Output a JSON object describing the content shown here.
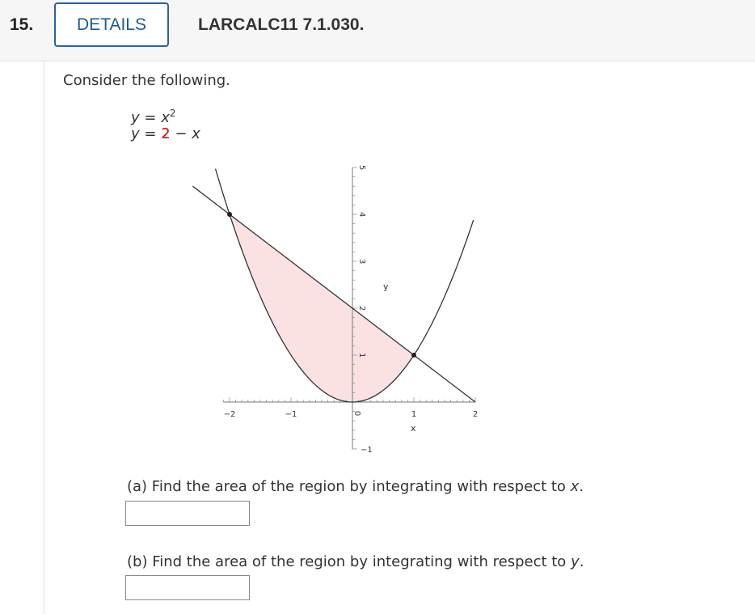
{
  "header": {
    "question_number": "15.",
    "details_label": "DETAILS",
    "question_code": "LARCALC11 7.1.030."
  },
  "prompt": "Consider the following.",
  "equations": {
    "eq1": {
      "lhs": "y",
      "eq": " = ",
      "base": "x",
      "exp": "2"
    },
    "eq2": {
      "lhs": "y",
      "eq": " = ",
      "red": "2",
      "rest": " − ",
      "var": "x"
    }
  },
  "graph": {
    "x_axis_label": "x",
    "y_axis_label": "y",
    "x_ticks": [
      "−2",
      "−1",
      "0",
      "1",
      "2"
    ],
    "y_ticks": [
      "5",
      "4",
      "3",
      "2",
      "1",
      "−1"
    ],
    "curve": "y = x^2",
    "line": "y = 2 − x",
    "xlim": [
      -2.1,
      2.0
    ],
    "ylim": [
      -1,
      5
    ],
    "intersections": [
      [
        -2,
        4
      ],
      [
        1,
        1
      ]
    ],
    "shade_color": "#fbe1e1"
  },
  "parts": {
    "a": {
      "text": "(a) Find the area of the region by integrating with respect to ",
      "var": "x",
      "end": ".",
      "answer": ""
    },
    "b": {
      "text": "(b) Find the area of the region by integrating with respect to ",
      "var": "y",
      "end": ".",
      "answer": ""
    }
  }
}
